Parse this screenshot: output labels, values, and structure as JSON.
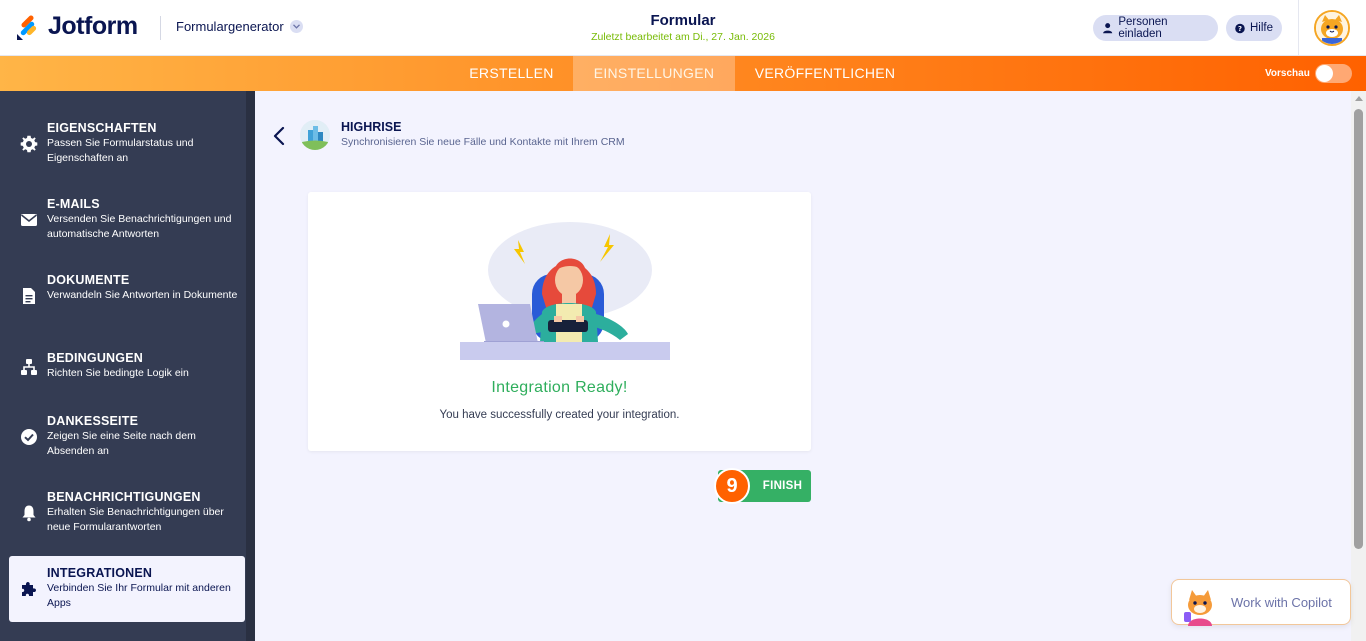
{
  "header": {
    "brand": "Jotform",
    "builder_label": "Formulargenerator",
    "form_title": "Formular",
    "last_edited": "Zuletzt bearbeitet am Di., 27. Jan. 2026",
    "invite_label": "Personen einladen",
    "help_label": "Hilfe"
  },
  "nav": {
    "tabs": [
      {
        "label": "ERSTELLEN",
        "active": false
      },
      {
        "label": "EINSTELLUNGEN",
        "active": true
      },
      {
        "label": "VERÖFFENTLICHEN",
        "active": false
      }
    ],
    "preview_label": "Vorschau",
    "preview_on": false
  },
  "sidebar": {
    "items": [
      {
        "title": "EIGENSCHAFTEN",
        "desc": "Passen Sie Formularstatus und Eigenschaften an",
        "icon": "gear-icon"
      },
      {
        "title": "E-MAILS",
        "desc": "Versenden Sie Benachrichtigungen und automatische Antworten",
        "icon": "envelope-icon"
      },
      {
        "title": "DOKUMENTE",
        "desc": "Verwandeln Sie Antworten in Dokumente",
        "icon": "document-icon"
      },
      {
        "title": "BEDINGUNGEN",
        "desc": "Richten Sie bedingte Logik ein",
        "icon": "sitemap-icon"
      },
      {
        "title": "DANKESSEITE",
        "desc": "Zeigen Sie eine Seite nach dem Absenden an",
        "icon": "check-circle-icon"
      },
      {
        "title": "BENACHRICHTIGUNGEN",
        "desc": "Erhalten Sie Benachrichtigungen über neue Formularantworten",
        "icon": "bell-icon"
      },
      {
        "title": "INTEGRATIONEN",
        "desc": "Verbinden Sie Ihr Formular mit anderen Apps",
        "icon": "puzzle-icon",
        "active": true
      }
    ]
  },
  "integration": {
    "name": "HIGHRISE",
    "description": "Synchronisieren Sie neue Fälle und Kontakte mit Ihrem CRM"
  },
  "result": {
    "title": "Integration Ready!",
    "message": "You have successfully created your integration.",
    "finish_label": "FINISH",
    "step_number": "9"
  },
  "copilot": {
    "label": "Work with Copilot"
  },
  "colors": {
    "accent_orange": "#ff6100",
    "success_green": "#35b065",
    "sidebar_bg": "#343c53",
    "navy": "#0a1551",
    "edited_green": "#78bb07"
  }
}
